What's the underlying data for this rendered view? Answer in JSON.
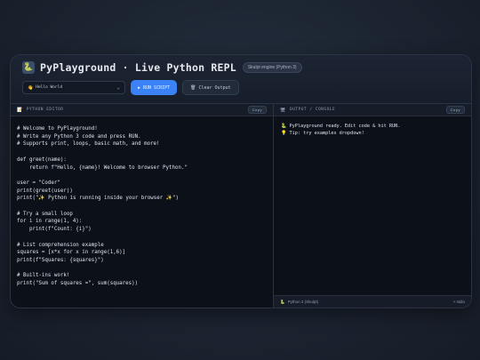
{
  "header": {
    "logo_emoji": "🐍",
    "title": "PyPlayground · Live Python REPL",
    "engine_badge": "Skulpt engine (Python 3)"
  },
  "controls": {
    "example_select": {
      "emoji": "👋",
      "value": "Hello World"
    },
    "run_icon": "▶",
    "run_label": "RUN SCRIPT",
    "clear_icon": "🗑",
    "clear_label": "Clear Output"
  },
  "editor": {
    "icon": "📝",
    "title": "PYTHON EDITOR",
    "copy_label": "Copy",
    "code": "# Welcome to PyPlayground!\n# Write any Python 3 code and press RUN.\n# Supports print, loops, basic math, and more!\n\ndef greet(name):\n    return f\"Hello, {name}! Welcome to browser Python.\"\n\nuser = \"Coder\"\nprint(greet(user))\nprint(\"✨ Python is running inside your browser ✨\")\n\n# Try a small loop\nfor i in range(1, 4):\n    print(f\"Count: {i}\")\n\n# List comprehension example\nsquares = [x*x for x in range(1,6)]\nprint(f\"Squares: {squares}\")\n\n# Built-ins work!\nprint(\"Sum of squares =\", sum(squares))"
  },
  "output": {
    "icon": "🖥",
    "title": "OUTPUT / CONSOLE",
    "copy_label": "Copy",
    "lines": [
      {
        "emoji": "🐍",
        "text": "PyPlayground ready. Edit code & hit RUN."
      },
      {
        "emoji": "💡",
        "text": "Tip: try examples dropdown!"
      }
    ],
    "status_emoji": "🐍",
    "status_text": "Python 3 (Skulpt)",
    "status_right": "> stdio"
  }
}
